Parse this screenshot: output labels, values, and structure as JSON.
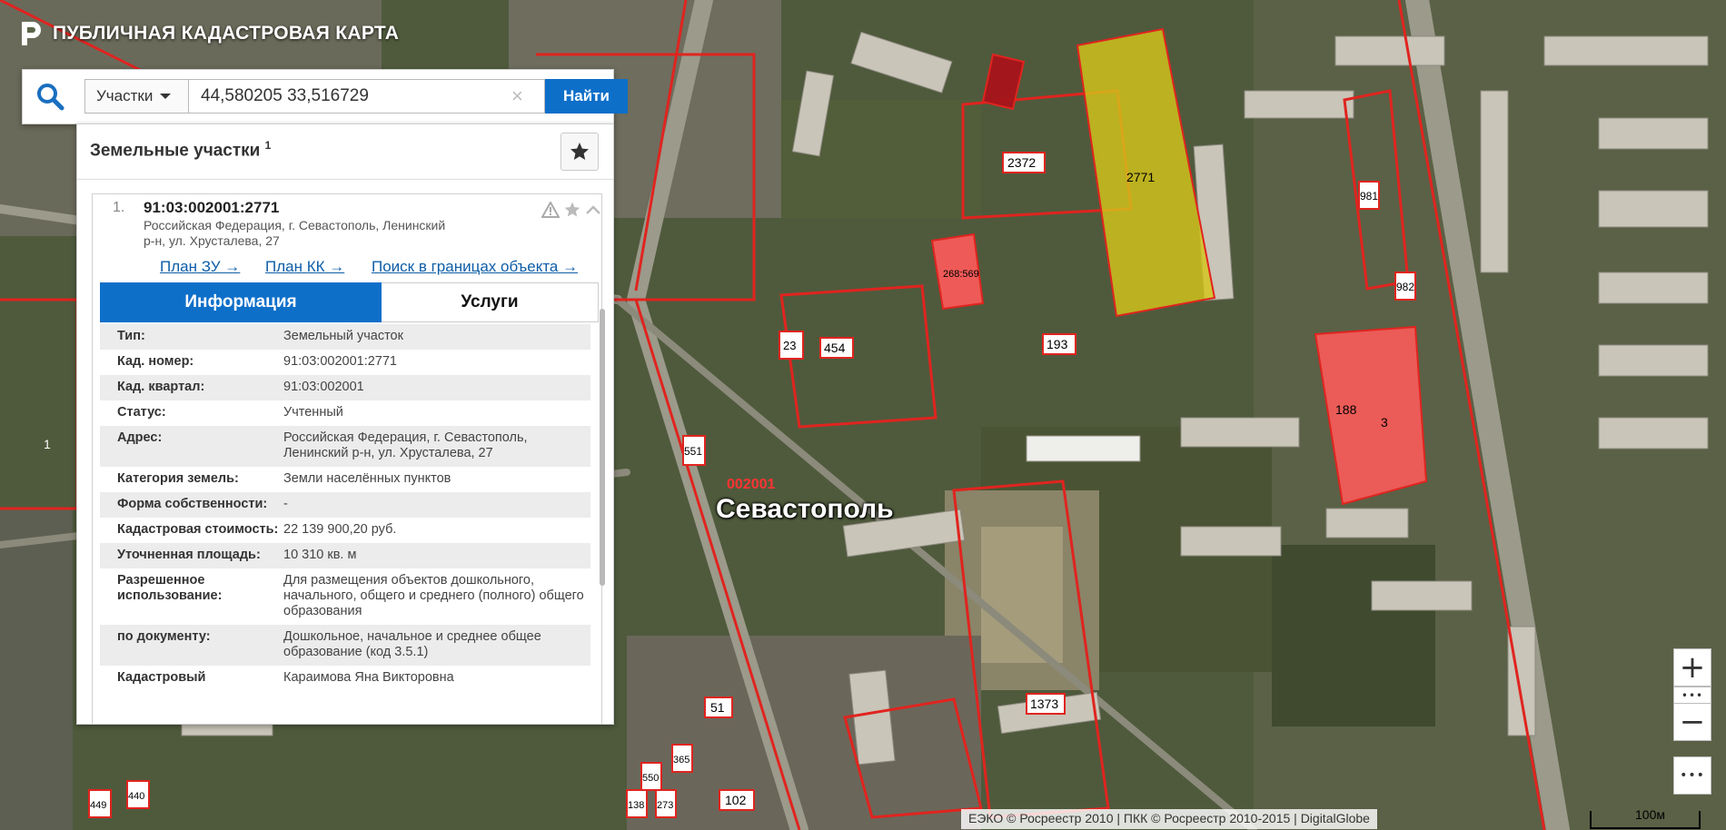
{
  "app": {
    "title": "ПУБЛИЧНАЯ КАДАСТРОВАЯ КАРТА"
  },
  "search": {
    "type_label": "Участки",
    "value": "44,580205 33,516729",
    "clear_symbol": "×",
    "button_label": "Найти"
  },
  "panel": {
    "title": "Земельные участки",
    "title_count": "1",
    "result": {
      "index": "1.",
      "number": "91:03:002001:2771",
      "address_line1": "Российская Федерация, г. Севастополь, Ленинский",
      "address_line2": "р-н, ул. Хрусталева, 27",
      "links": [
        "План ЗУ →",
        "План КК →",
        "Поиск в границах объекта →"
      ]
    },
    "tabs": {
      "info": "Информация",
      "services": "Услуги"
    },
    "rows": [
      {
        "key": "Тип:",
        "value": "Земельный участок"
      },
      {
        "key": "Кад. номер:",
        "value": "91:03:002001:2771"
      },
      {
        "key": "Кад. квартал:",
        "value": "91:03:002001"
      },
      {
        "key": "Статус:",
        "value": "Учтенный"
      },
      {
        "key": "Адрес:",
        "value": "Российская Федерация, г. Севастополь, Ленинский р-н, ул. Хрусталева, 27"
      },
      {
        "key": "Категория земель:",
        "value": "Земли населённых пунктов"
      },
      {
        "key": "Форма собственности:",
        "value": "-"
      },
      {
        "key": "Кадастровая стоимость:",
        "value": "22 139 900,20 руб."
      },
      {
        "key": "Уточненная площадь:",
        "value": "10 310 кв. м"
      },
      {
        "key": "Разрешенное использование:",
        "value": "Для размещения объектов дошкольного, начального, общего и среднего (полного) общего образования"
      },
      {
        "key": "по документу:",
        "value": "Дошкольное, начальное и среднее общее образование (код 3.5.1)"
      },
      {
        "key": "Кадастровый",
        "value": "Караимова Яна Викторовна"
      }
    ]
  },
  "map": {
    "city_label": "Севастополь",
    "quarter_label": "002001",
    "parcel_labels": [
      "2771",
      "2372",
      "981",
      "982",
      "268:569",
      "23",
      "454",
      "193",
      "188",
      "3",
      "551",
      "1373",
      "51",
      "365",
      "550",
      "138",
      "273",
      "102",
      "449",
      "440",
      "1"
    ],
    "copyright": "ЕЭКО © Росреестр 2010 | ПКК © Росреестр 2010-2015 | DigitalGlobe",
    "scale_label": "100м"
  },
  "controls": {
    "zoom_in": "+",
    "zoom_out": "−",
    "more": "•••"
  },
  "colors": {
    "accent": "#0e6fc9",
    "parcel_border": "#e0241f",
    "selected_fill": "#d4c51a",
    "building_fill": "#ff5a5a"
  }
}
